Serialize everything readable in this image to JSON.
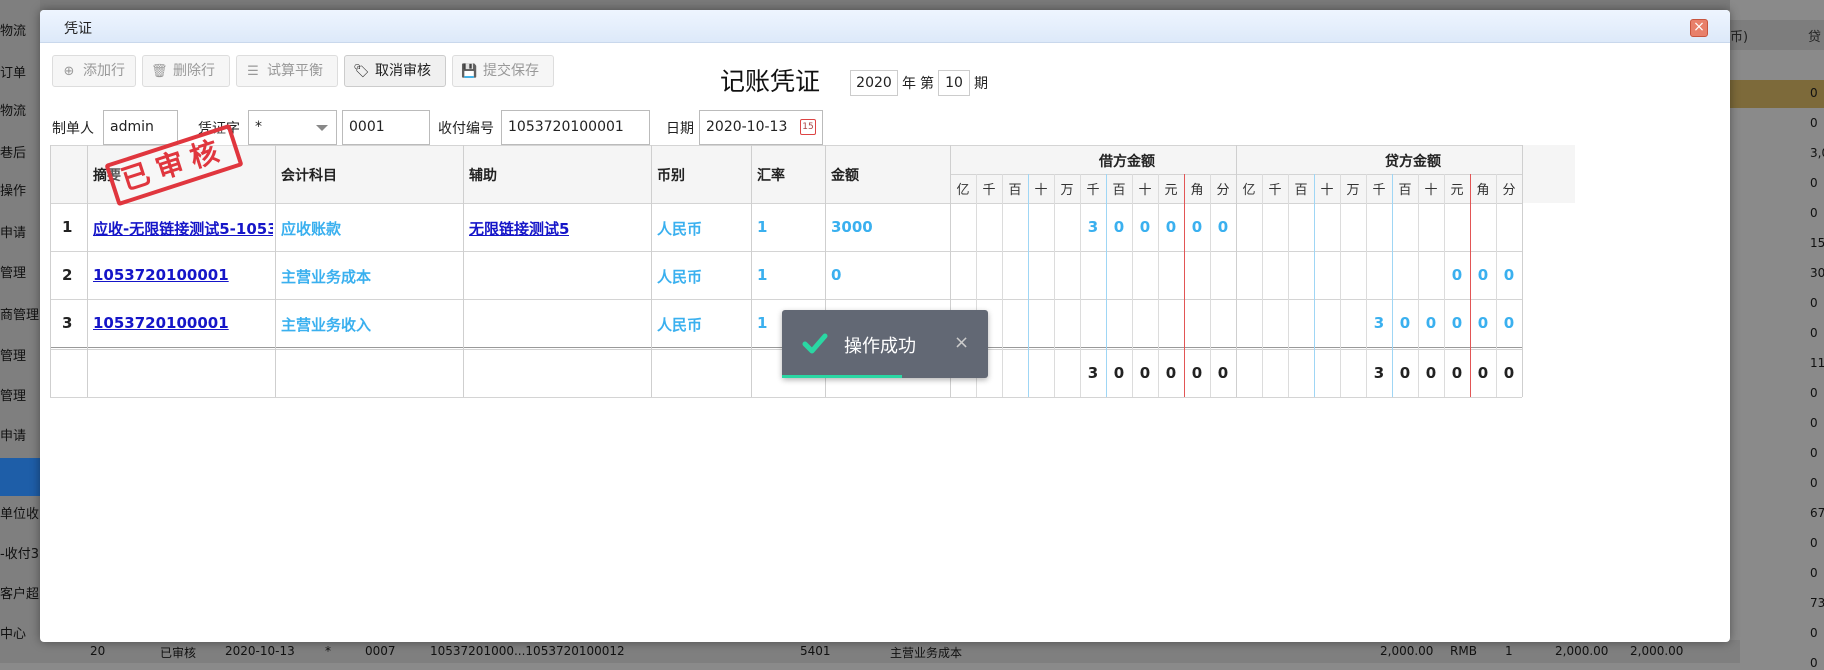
{
  "background": {
    "sidebar_items": [
      "物流",
      "订单",
      "物流",
      "巷后",
      "操作",
      "申请",
      "管理",
      "商管理",
      "管理",
      "管理",
      "申请",
      "单位收",
      "-收付3",
      "客户超",
      "中心"
    ],
    "right_header": "币)",
    "right_header2": "贷",
    "right_values": [
      "0",
      "0",
      "3,0",
      "0",
      "0",
      "15",
      "30",
      "0",
      "0",
      "11",
      "0",
      "0",
      "0",
      "0",
      "67",
      "0",
      "0",
      "73",
      "0",
      "0"
    ],
    "bottom_row": [
      "20",
      "已审核",
      "2020-10-13",
      "*",
      "0007",
      "10537201000...1053720100012",
      "5401",
      "主营业务成本",
      "2,000.00",
      "RMB",
      "1",
      "2,000.00",
      "2,000.00"
    ]
  },
  "dialog": {
    "title": "凭证",
    "close_icon": "×",
    "toolbar": {
      "add_row": "添加行",
      "delete_row": "删除行",
      "trial_balance": "试算平衡",
      "cancel_audit": "取消审核",
      "submit_save": "提交保存"
    },
    "voucher_title": "记账凭证",
    "year_value": "2020",
    "year_label": "年",
    "period_prefix": "第",
    "period_value": "10",
    "period_label": "期",
    "form": {
      "maker_label": "制单人",
      "maker_value": "admin",
      "voucher_type_label": "凭证字",
      "voucher_type_value": "*",
      "voucher_no_value": "0001",
      "receipt_no_label": "收付编号",
      "receipt_no_value": "1053720100001",
      "date_label": "日期",
      "date_value": "2020-10-13",
      "calendar_icon": "15"
    },
    "grid": {
      "headers": {
        "summary": "摘要",
        "account": "会计科目",
        "auxiliary": "辅助",
        "currency": "币别",
        "rate": "汇率",
        "amount": "金额",
        "debit": "借方金额",
        "credit": "贷方金额"
      },
      "digit_units": [
        "亿",
        "千",
        "百",
        "十",
        "万",
        "千",
        "百",
        "十",
        "元",
        "角",
        "分"
      ],
      "rows": [
        {
          "no": "1",
          "summary": "应收-无限链接测试5-1053",
          "account": "应收账款",
          "auxiliary": "无限链接测试5",
          "currency": "人民币",
          "rate": "1",
          "amount": "3000",
          "debit_digits": [
            "",
            "",
            "",
            "",
            "",
            "3",
            "0",
            "0",
            "0",
            "0",
            "0"
          ],
          "credit_digits": [
            "",
            "",
            "",
            "",
            "",
            "",
            "",
            "",
            "",
            "",
            ""
          ]
        },
        {
          "no": "2",
          "summary": "1053720100001",
          "account": "主营业务成本",
          "auxiliary": "",
          "currency": "人民币",
          "rate": "1",
          "amount": "0",
          "debit_digits": [
            "",
            "",
            "",
            "",
            "",
            "",
            "",
            "",
            "",
            "",
            ""
          ],
          "credit_digits": [
            "",
            "",
            "",
            "",
            "",
            "",
            "",
            "",
            "0",
            "0",
            "0"
          ]
        },
        {
          "no": "3",
          "summary": "1053720100001",
          "account": "主营业务收入",
          "auxiliary": "",
          "currency": "人民币",
          "rate": "1",
          "amount": "",
          "debit_digits": [
            "",
            "",
            "",
            "",
            "",
            "",
            "",
            "",
            "",
            "",
            ""
          ],
          "credit_digits": [
            "",
            "",
            "",
            "",
            "",
            "3",
            "0",
            "0",
            "0",
            "0",
            "0"
          ]
        }
      ],
      "total_debit_digits": [
        "",
        "",
        "",
        "",
        "",
        "3",
        "0",
        "0",
        "0",
        "0",
        "0"
      ],
      "total_credit_digits": [
        "",
        "",
        "",
        "",
        "",
        "3",
        "0",
        "0",
        "0",
        "0",
        "0"
      ]
    },
    "stamp_text": "已审核"
  },
  "toast": {
    "message": "操作成功",
    "close": "×"
  },
  "colors": {
    "link": "#1515c8",
    "value_blue": "#3ab0ef",
    "stamp_red": "#e0363e",
    "toast_bg": "#626874",
    "toast_accent": "#2ad7a3"
  }
}
